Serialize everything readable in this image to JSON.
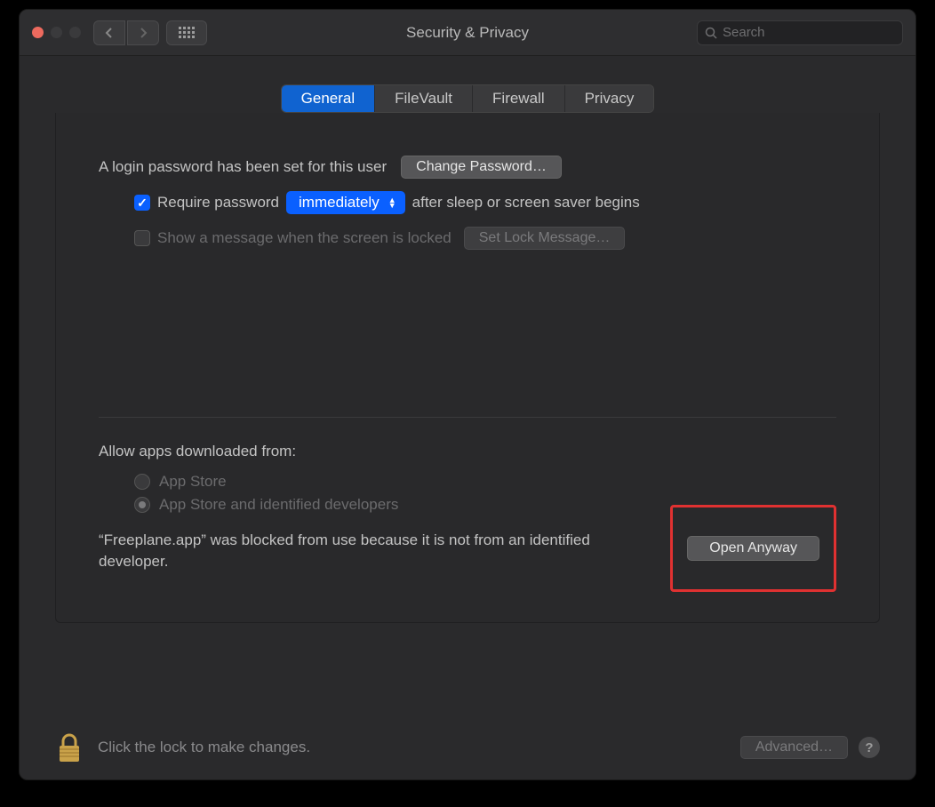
{
  "window": {
    "title": "Security & Privacy"
  },
  "search": {
    "placeholder": "Search"
  },
  "tabs": {
    "items": [
      {
        "label": "General",
        "active": true
      },
      {
        "label": "FileVault",
        "active": false
      },
      {
        "label": "Firewall",
        "active": false
      },
      {
        "label": "Privacy",
        "active": false
      }
    ]
  },
  "general": {
    "login_password_text": "A login password has been set for this user",
    "change_password_label": "Change Password…",
    "require_password_label": "Require password",
    "require_password_delay": "immediately",
    "require_password_suffix": "after sleep or screen saver begins",
    "show_message_label": "Show a message when the screen is locked",
    "set_lock_message_label": "Set Lock Message…",
    "allow_apps_label": "Allow apps downloaded from:",
    "radio_appstore": "App Store",
    "radio_identified": "App Store and identified developers",
    "blocked_message": "“Freeplane.app” was blocked from use because it is not from an identified developer.",
    "open_anyway_label": "Open Anyway"
  },
  "footer": {
    "lock_text": "Click the lock to make changes.",
    "advanced_label": "Advanced…"
  }
}
